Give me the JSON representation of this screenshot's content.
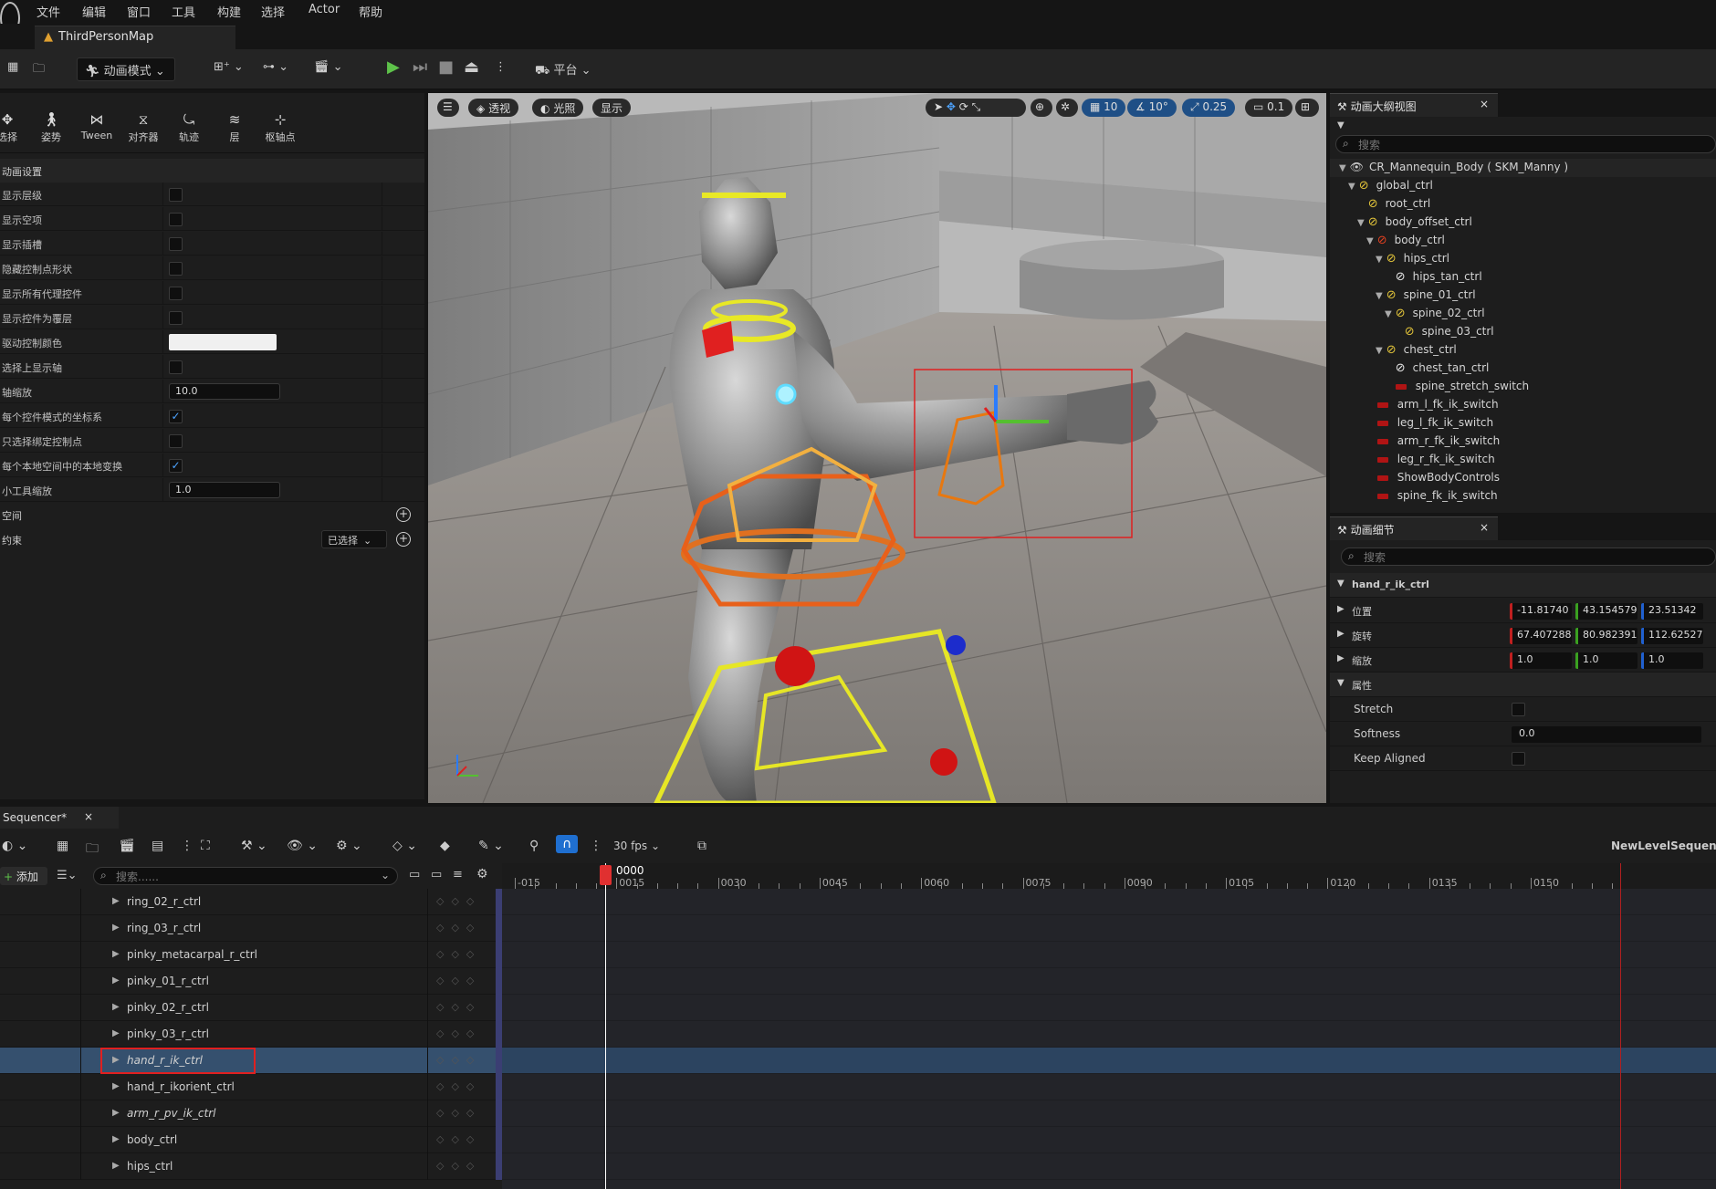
{
  "menu": [
    "文件",
    "编辑",
    "窗口",
    "工具",
    "构建",
    "选择",
    "Actor",
    "帮助"
  ],
  "map_tab": "ThirdPersonMap",
  "toolbar": {
    "mode_label": "动画模式",
    "platform_label": "平台"
  },
  "tool_icons": [
    {
      "label": "选择",
      "icon": "select-icon"
    },
    {
      "label": "姿势",
      "icon": "pose-icon"
    },
    {
      "label": "Tween",
      "icon": "tween-icon"
    },
    {
      "label": "对齐器",
      "icon": "snapper-icon"
    },
    {
      "label": "轨迹",
      "icon": "trail-icon"
    },
    {
      "label": "层",
      "icon": "layers-icon"
    },
    {
      "label": "枢轴点",
      "icon": "pivot-icon"
    }
  ],
  "anim_settings": {
    "section_label": "动画设置",
    "rows": [
      {
        "label": "显示层级",
        "type": "checkbox",
        "checked": false
      },
      {
        "label": "显示空项",
        "type": "checkbox",
        "checked": false
      },
      {
        "label": "显示插槽",
        "type": "checkbox",
        "checked": false
      },
      {
        "label": "隐藏控制点形状",
        "type": "checkbox",
        "checked": false
      },
      {
        "label": "显示所有代理控件",
        "type": "checkbox",
        "checked": false
      },
      {
        "label": "显示控件为覆层",
        "type": "checkbox",
        "checked": false
      },
      {
        "label": "驱动控制颜色",
        "type": "color",
        "value": "#f0f0f0"
      },
      {
        "label": "选择上显示轴",
        "type": "checkbox",
        "checked": false
      },
      {
        "label": "轴缩放",
        "type": "text",
        "value": "10.0"
      },
      {
        "label": "每个控件模式的坐标系",
        "type": "checkbox",
        "checked": true
      },
      {
        "label": "只选择绑定控制点",
        "type": "checkbox",
        "checked": false
      },
      {
        "label": "每个本地空间中的本地变换",
        "type": "checkbox",
        "checked": true
      },
      {
        "label": "小工具缩放",
        "type": "text",
        "value": "1.0"
      }
    ],
    "space_label": "空间",
    "constraint_label": "约束",
    "constraint_dropdown": "已选择"
  },
  "viewport": {
    "perspective_label": "透视",
    "lit_label": "光照",
    "show_label": "显示",
    "grid_snap": "10",
    "rot_snap": "10°",
    "scale_snap": "0.25",
    "cam_speed": "0.1"
  },
  "outliner": {
    "title": "动画大纲视图",
    "search_placeholder": "搜索",
    "items": [
      {
        "label": "CR_Mannequin_Body ( SKM_Manny )",
        "depth": 0,
        "kind": "root",
        "expand": true
      },
      {
        "label": "global_ctrl",
        "depth": 1,
        "kind": "bone",
        "expand": true
      },
      {
        "label": "root_ctrl",
        "depth": 2,
        "kind": "bone",
        "expand": false
      },
      {
        "label": "body_offset_ctrl",
        "depth": 2,
        "kind": "bone",
        "expand": true
      },
      {
        "label": "body_ctrl",
        "depth": 3,
        "kind": "bone-red",
        "expand": true
      },
      {
        "label": "hips_ctrl",
        "depth": 4,
        "kind": "bone",
        "expand": true
      },
      {
        "label": "hips_tan_ctrl",
        "depth": 5,
        "kind": "bone-white",
        "expand": false
      },
      {
        "label": "spine_01_ctrl",
        "depth": 4,
        "kind": "bone",
        "expand": true
      },
      {
        "label": "spine_02_ctrl",
        "depth": 5,
        "kind": "bone",
        "expand": true
      },
      {
        "label": "spine_03_ctrl",
        "depth": 6,
        "kind": "bone",
        "expand": false
      },
      {
        "label": "chest_ctrl",
        "depth": 4,
        "kind": "bone",
        "expand": true
      },
      {
        "label": "chest_tan_ctrl",
        "depth": 5,
        "kind": "bone-white",
        "expand": false
      },
      {
        "label": "spine_stretch_switch",
        "depth": 5,
        "kind": "bar",
        "expand": false
      },
      {
        "label": "arm_l_fk_ik_switch",
        "depth": 3,
        "kind": "bar",
        "expand": false
      },
      {
        "label": "leg_l_fk_ik_switch",
        "depth": 3,
        "kind": "bar",
        "expand": false
      },
      {
        "label": "arm_r_fk_ik_switch",
        "depth": 3,
        "kind": "bar",
        "expand": false
      },
      {
        "label": "leg_r_fk_ik_switch",
        "depth": 3,
        "kind": "bar",
        "expand": false
      },
      {
        "label": "ShowBodyControls",
        "depth": 3,
        "kind": "bar",
        "expand": false
      },
      {
        "label": "spine_fk_ik_switch",
        "depth": 3,
        "kind": "bar",
        "expand": false
      }
    ]
  },
  "details": {
    "title": "动画细节",
    "search_placeholder": "搜索",
    "control_name": "hand_r_ik_ctrl",
    "location_label": "位置",
    "location": [
      "-11.81740",
      "43.154579",
      "23.51342"
    ],
    "rotation_label": "旋转",
    "rotation": [
      "67.407288",
      "80.982391",
      "112.62527"
    ],
    "scale_label": "缩放",
    "scale": [
      "1.0",
      "1.0",
      "1.0"
    ],
    "attributes_label": "属性",
    "stretch_label": "Stretch",
    "softness_label": "Softness",
    "softness": "0.0",
    "keep_aligned_label": "Keep Aligned"
  },
  "sequencer": {
    "tab_label": "Sequencer*",
    "fps": "30 fps",
    "sequence_name": "NewLevelSequence",
    "add_label": "添加",
    "search_placeholder": "搜索......",
    "current_frame": "0000",
    "ticks": [
      "-015",
      "0015",
      "0030",
      "0045",
      "0060",
      "0075",
      "0090",
      "0105",
      "0120",
      "0135",
      "0150"
    ],
    "tracks": [
      {
        "name": "ring_02_r_ctrl",
        "selected": false,
        "italic": false
      },
      {
        "name": "ring_03_r_ctrl",
        "selected": false,
        "italic": false
      },
      {
        "name": "pinky_metacarpal_r_ctrl",
        "selected": false,
        "italic": false
      },
      {
        "name": "pinky_01_r_ctrl",
        "selected": false,
        "italic": false
      },
      {
        "name": "pinky_02_r_ctrl",
        "selected": false,
        "italic": false
      },
      {
        "name": "pinky_03_r_ctrl",
        "selected": false,
        "italic": false
      },
      {
        "name": "hand_r_ik_ctrl",
        "selected": true,
        "italic": true
      },
      {
        "name": "hand_r_ikorient_ctrl",
        "selected": false,
        "italic": false
      },
      {
        "name": "arm_r_pv_ik_ctrl",
        "selected": false,
        "italic": true
      },
      {
        "name": "body_ctrl",
        "selected": false,
        "italic": false
      },
      {
        "name": "hips_ctrl",
        "selected": false,
        "italic": false
      }
    ]
  },
  "colors": {
    "accent": "#1f6fd0",
    "selection": "#35506e",
    "red": "#e03030",
    "bone_yellow": "#e2c43a"
  }
}
